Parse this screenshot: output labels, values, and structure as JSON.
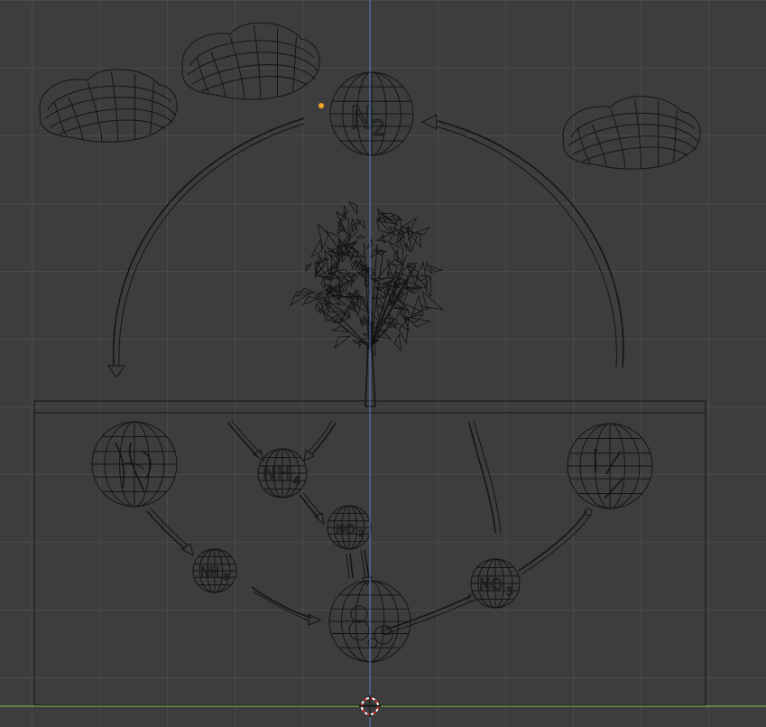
{
  "app": "3D viewport (wireframe)",
  "colors": {
    "background": "#3d3d3d",
    "grid": "#4a4a4a",
    "wire": "#151515",
    "y_axis": "#4a7fc1",
    "x_axis": "#8bc34a",
    "origin_dot": "#f5a623",
    "cursor_red": "#d62828"
  },
  "labels": {
    "n2": "N",
    "n2_sub": "2",
    "nh4": "NH",
    "nh4_sub": "4",
    "no2": "NO",
    "no2_sub": "2",
    "nh3": "NH",
    "nh3_sub": "3",
    "no3": "NO",
    "no3_sub": "3"
  },
  "objects": [
    "cloud-left",
    "cloud-center",
    "cloud-right",
    "n2-sphere",
    "tree",
    "soil-box",
    "bacteria-sphere-left",
    "bacteria-sphere-right",
    "nh4-sphere",
    "no2-sphere",
    "nh3-sphere",
    "no3-sphere",
    "root-sphere",
    "arrow-left-arc",
    "arrow-right-arc"
  ]
}
